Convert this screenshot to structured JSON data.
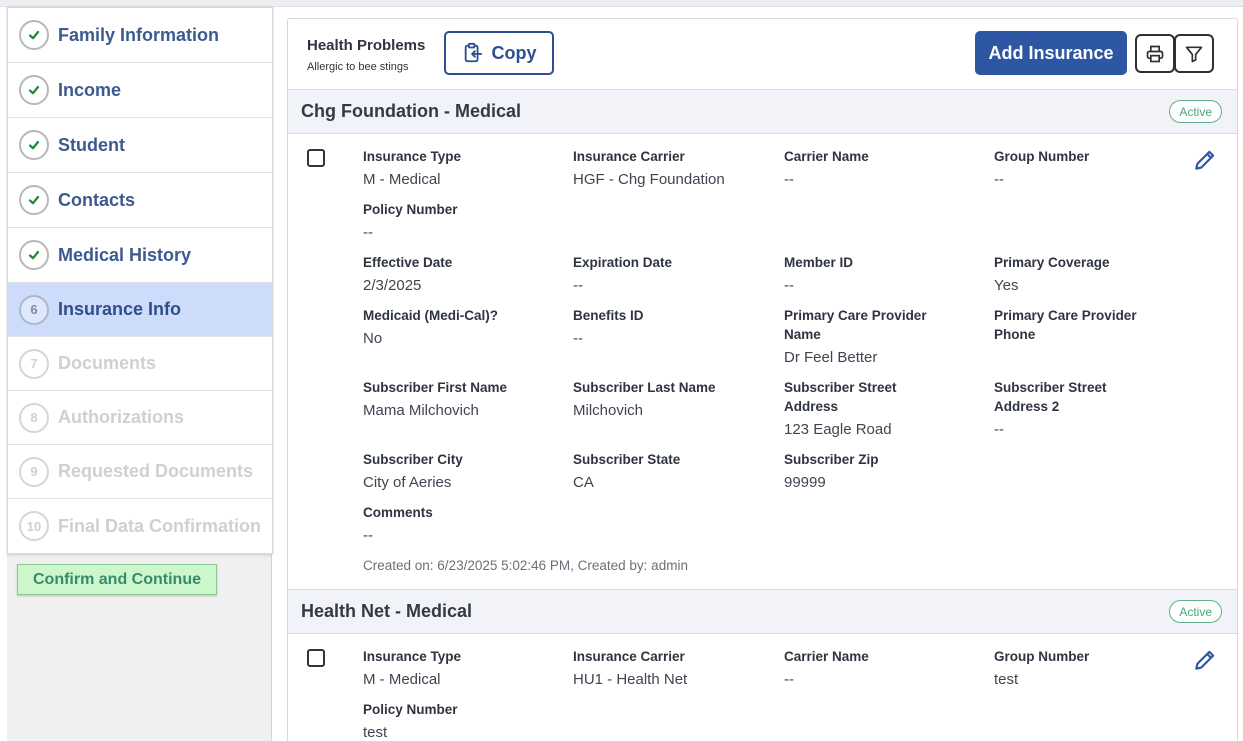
{
  "sidebar": {
    "steps": [
      {
        "label": "Family Information",
        "marker": "",
        "status": "done"
      },
      {
        "label": "Income",
        "marker": "",
        "status": "done"
      },
      {
        "label": "Student",
        "marker": "",
        "status": "done"
      },
      {
        "label": "Contacts",
        "marker": "",
        "status": "done"
      },
      {
        "label": "Medical History",
        "marker": "",
        "status": "done"
      },
      {
        "label": "Insurance Info",
        "marker": "6",
        "status": "active"
      },
      {
        "label": "Documents",
        "marker": "7",
        "status": "disabled"
      },
      {
        "label": "Authorizations",
        "marker": "8",
        "status": "disabled"
      },
      {
        "label": "Requested Documents",
        "marker": "9",
        "status": "disabled"
      },
      {
        "label": "Final Data Confirmation",
        "marker": "10",
        "status": "disabled"
      }
    ],
    "confirm_label": "Confirm and Continue"
  },
  "header": {
    "title": "Health Problems",
    "subtitle": "Allergic to bee stings",
    "copy_label": "Copy",
    "add_label": "Add Insurance"
  },
  "records": [
    {
      "name": "Chg Foundation - Medical",
      "status": "Active",
      "fields": {
        "insurance_type": {
          "label": "Insurance Type",
          "value": "M - Medical"
        },
        "insurance_carrier": {
          "label": "Insurance Carrier",
          "value": "HGF - Chg Foundation"
        },
        "carrier_name": {
          "label": "Carrier Name",
          "value": "--"
        },
        "group_number": {
          "label": "Group Number",
          "value": "--"
        },
        "policy_number": {
          "label": "Policy Number",
          "value": "--"
        },
        "effective_date": {
          "label": "Effective Date",
          "value": "2/3/2025"
        },
        "expiration_date": {
          "label": "Expiration Date",
          "value": "--"
        },
        "member_id": {
          "label": "Member ID",
          "value": "--"
        },
        "primary_coverage": {
          "label": "Primary Coverage",
          "value": "Yes"
        },
        "medicaid": {
          "label": "Medicaid (Medi-Cal)?",
          "value": "No"
        },
        "benefits_id": {
          "label": "Benefits ID",
          "value": "--"
        },
        "pcp_name": {
          "label_line1": "Primary Care Provider",
          "label_line2": "Name",
          "value": "Dr Feel Better"
        },
        "pcp_phone": {
          "label_line1": "Primary Care Provider",
          "label_line2": "Phone",
          "value": ""
        },
        "sub_first": {
          "label": "Subscriber First Name",
          "value": "Mama Milchovich"
        },
        "sub_last": {
          "label": "Subscriber Last Name",
          "value": "Milchovich"
        },
        "sub_street": {
          "label_line1": "Subscriber Street",
          "label_line2": "Address",
          "value": "123 Eagle Road"
        },
        "sub_street2": {
          "label_line1": "Subscriber Street",
          "label_line2": "Address 2",
          "value": "--"
        },
        "sub_city": {
          "label": "Subscriber City",
          "value": "City of Aeries"
        },
        "sub_state": {
          "label": "Subscriber State",
          "value": "CA"
        },
        "sub_zip": {
          "label": "Subscriber Zip",
          "value": "99999"
        },
        "comments": {
          "label": "Comments",
          "value": "--"
        }
      },
      "created": "Created on: 6/23/2025 5:02:46 PM, Created by: admin"
    },
    {
      "name": "Health Net - Medical",
      "status": "Active",
      "fields": {
        "insurance_type": {
          "label": "Insurance Type",
          "value": "M - Medical"
        },
        "insurance_carrier": {
          "label": "Insurance Carrier",
          "value": "HU1 - Health Net"
        },
        "carrier_name": {
          "label": "Carrier Name",
          "value": "--"
        },
        "group_number": {
          "label": "Group Number",
          "value": "test"
        },
        "policy_number": {
          "label": "Policy Number",
          "value": "test"
        }
      }
    }
  ],
  "colors": {
    "primary": "#2e57a3",
    "nav_text": "#3d5a8f",
    "active_step_bg": "#cddcfa",
    "status_green": "#4aa57a",
    "confirm_bg": "#ccf7cc"
  },
  "icons": {
    "done": "checkmark-icon",
    "copy": "clipboard-copy-icon",
    "print": "printer-icon",
    "filter": "funnel-icon",
    "edit": "pencil-icon"
  }
}
